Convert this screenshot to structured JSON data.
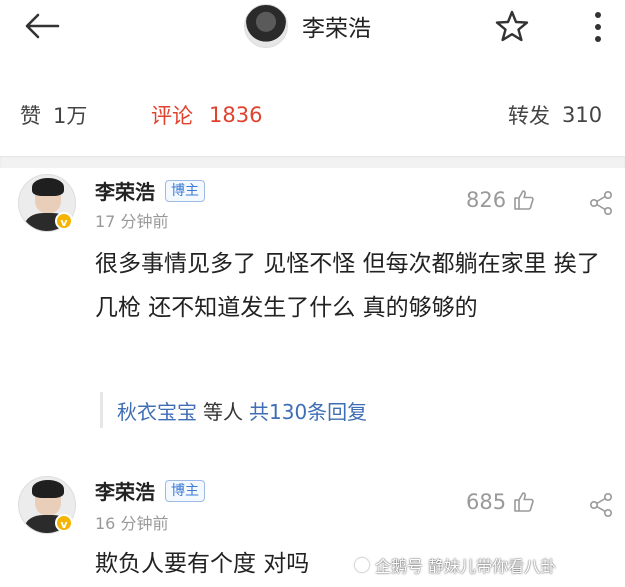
{
  "header": {
    "title": "李荣浩"
  },
  "stats": {
    "likes_label": "赞",
    "likes_value": "1万",
    "comments_label": "评论",
    "comments_value": "1836",
    "reposts_label": "转发",
    "reposts_value": "310"
  },
  "colors": {
    "accent_red": "#e0422e",
    "link_blue": "#3f6eb5",
    "verified_gold": "#f5b400"
  },
  "comments": [
    {
      "author": "李荣浩",
      "tag": "博主",
      "time": "17 分钟前",
      "likes": "826",
      "text": "很多事情见多了 见怪不怪 但每次都躺在家里 挨了几枪 还不知道发生了什么 真的够够的",
      "replies": {
        "who": "秋衣宝宝",
        "etc": "等人",
        "count": "共130条回复"
      }
    },
    {
      "author": "李荣浩",
      "tag": "博主",
      "time": "16 分钟前",
      "likes": "685",
      "text": "欺负人要有个度 对吗"
    }
  ],
  "watermark": "企鹅号 静妹儿带你看八卦",
  "icons": {
    "back": "back-arrow-icon",
    "star": "star-icon",
    "more": "more-vertical-icon",
    "like": "thumbs-up-icon",
    "share": "share-icon",
    "verified": "verified-badge-icon"
  }
}
